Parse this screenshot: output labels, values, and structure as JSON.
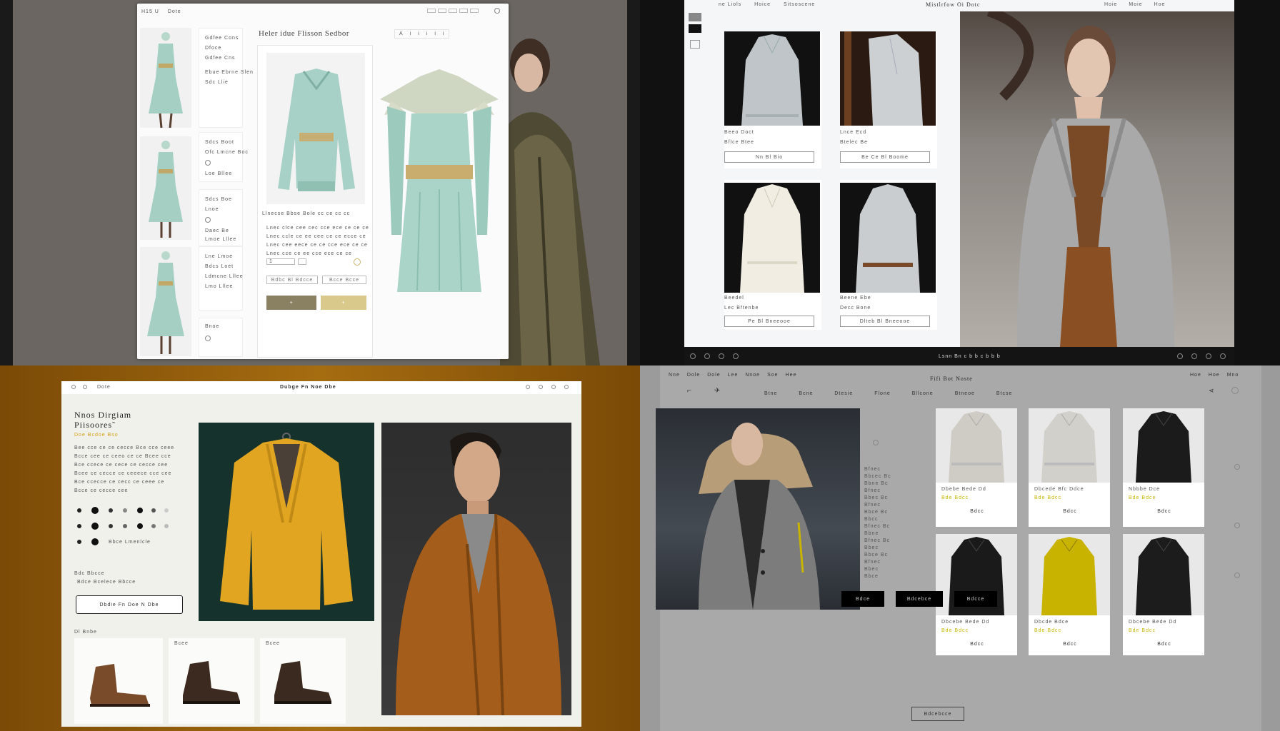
{
  "tl": {
    "nav": [
      "H15 U",
      "Dote"
    ],
    "title": "Heler idue Flisson Sedbor",
    "size_tabs": [
      "A",
      "i",
      "i",
      "i",
      "i",
      "i"
    ],
    "thumb_captions": [
      [
        "Gdfee Cons",
        "Dfoce",
        "Gdfee Cns",
        "Ebue Ebrne Slen",
        "Sdc Llie"
      ],
      [
        "Sdcs Boot",
        "Ofc Lmcne Boc",
        "Loe Bllee"
      ],
      [
        "Sdcs Boe",
        "Lnoe",
        "Daec Be",
        "Lmoe Lllee"
      ],
      [
        "Lne Lmoe",
        "Bdcs Loet",
        "Ldmcne Lllee",
        "Lmo Lllee"
      ],
      [
        "Bnoe"
      ]
    ],
    "product_meta": "Llnecse Bbse Bole  cc    ce  cc  cc",
    "desc_lines": [
      "Lnec clce cee cec cce ece ce ce ce",
      "Lnec ccle ce ee cee ce ce ecce ce",
      "Lnec cee eece ce ce cce ece ce ce",
      "Lnec cce ce ee cce ece ce ce"
    ],
    "qty": "1",
    "secondary_btns": [
      "Bdbc  Bl  Bdcce",
      "Bcce Bcce"
    ],
    "primary_btns": [
      "+",
      "+"
    ],
    "accent_olive": "#8a8162",
    "accent_gold": "#d9c98a"
  },
  "tr": {
    "nav": [
      "ne Liols",
      "Hoice",
      "Sitsoscene"
    ],
    "title": "Mistlrfow Oi Dotc",
    "nav_right": [
      "Hoie",
      "Moie",
      "Hoe"
    ],
    "products": [
      {
        "name": "Beeo Doct",
        "price": "Bflce Btee",
        "btn": "Nn Bl Bio"
      },
      {
        "name": "Lnce Ecd",
        "price": "Btelec Be",
        "btn": "Be Ce Bl Boome"
      },
      {
        "name": "Beedel",
        "price": "Lec Bftenbe",
        "btn": "Pe Bl Bneeooe"
      },
      {
        "name": "Beene Ebe",
        "price": "Decc Bone",
        "btn": "Dlteb Bl Bneeooe"
      }
    ],
    "footer_label": "Lsnn Bn c b b c b b b"
  },
  "bl": {
    "nav_center": "Dubge  Fn  Noe  Dbe",
    "heading_line1": "Nnos  Dirgiam",
    "heading_line2": "Piisoores˜",
    "subtitle": "Doe  Bcdoe Bso",
    "desc_lines": [
      "Bee cce ce ce cecce Bce cce ceee",
      "Bcce cee ce ceeo ce ce Bcee cce",
      "Bce ccece ce cece ce cecce cee",
      "Bcee ce cecce ce ceeece cce cee",
      "Bce ccecce ce cecc ce ceee ce",
      "Bcce ce cecce cee"
    ],
    "dot_label": "Bbce   Lmenlcle",
    "size_note": "Bdc Bbcce",
    "size_sub": "Bdce Bcelece Bbcce",
    "cta": "Dbdie  Fn  Doe  N  Dbe",
    "shoe_label": "Dl  Bnbe",
    "shoe_tags": [
      "Bcee",
      "Bcee"
    ],
    "accent": "#d4a017"
  },
  "br": {
    "nav_left": [
      "Nne",
      "Dole",
      "Dole",
      "Lee",
      "Nnoe",
      "Soe",
      "Hee"
    ],
    "title": "Fifi Bot Noste",
    "nav_right": [
      "Hoe",
      "Hoe",
      "Mno"
    ],
    "subnav": [
      "Btne",
      "Bcne",
      "Dtesie",
      "Flone",
      "Bllcone",
      "Btneoe",
      "Btcse"
    ],
    "filter_items": [
      "Bfnec",
      "Bbcec Bc",
      "Bbne Bc",
      "Bfnec",
      "Bbec Bc",
      "Bfnec",
      "Bbce Bc",
      "Bbcc",
      "Bfnec Bc",
      "Bbne",
      "Bfnec Bc",
      "Bbec",
      "Bbce Bc",
      "Bfnec",
      "Bbec",
      "Bbce"
    ],
    "products": [
      {
        "name": "Dbebe Bede Dd",
        "price": "Bde Bdcc",
        "btn": "Bdcc"
      },
      {
        "name": "Dbcede Bfc Ddce",
        "price": "Bde Bdcc",
        "btn": "Bdcc"
      },
      {
        "name": "Nbbbe Dce",
        "price": "Bde Bdce",
        "btn": "Bdcc"
      },
      {
        "name": "Dbcebe Bede Dd",
        "price": "Bde Bdcc",
        "btn": "Bdcc"
      },
      {
        "name": "Dbcde Bdce",
        "price": "Bde Bdcc",
        "btn": "Bdcc"
      },
      {
        "name": "Dbcebe Bede Dd",
        "price": "Bde Bdcc",
        "btn": "Bdcc"
      }
    ],
    "pager": [
      "Bdce",
      "Bdcebce",
      "Bdcce"
    ],
    "load_more": "Bdcebcce",
    "accent": "#c8b400"
  }
}
